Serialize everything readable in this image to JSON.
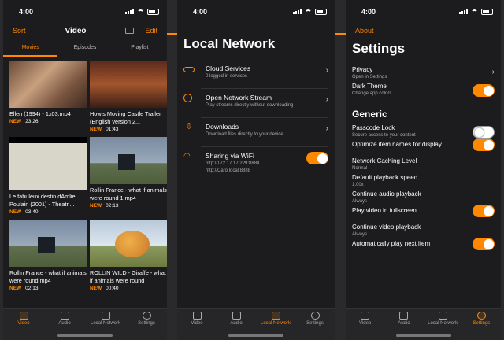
{
  "status": {
    "time": "4:00"
  },
  "colors": {
    "accent": "#ff8800",
    "background": "#1c1c1e"
  },
  "screen1": {
    "nav": {
      "left": "Sort",
      "title": "Video",
      "right": "Edit",
      "cast_icon": "cast-icon"
    },
    "tabs": [
      "Movies",
      "Episodes",
      "Playlist"
    ],
    "videos": [
      {
        "title": "Ellen (1994) - 1x03.mp4",
        "badge": "NEW",
        "duration": "23:26"
      },
      {
        "title": "Howls Moving Castle Trailer (English version 2...",
        "badge": "NEW",
        "duration": "01:43"
      },
      {
        "title": "Le fabuleux destin dAmlie Poulain (2001) - Theatri...",
        "badge": "NEW",
        "duration": "03:40"
      },
      {
        "title": "Rollin France - what if animals were round 1.mp4",
        "badge": "NEW",
        "duration": "02:13"
      },
      {
        "title": "Rollin France - what if animals were round.mp4",
        "badge": "NEW",
        "duration": "02:13"
      },
      {
        "title": "ROLLIN WILD - Giraffe - what if animals were round",
        "badge": "NEW",
        "duration": "00:40"
      }
    ]
  },
  "screen2": {
    "title": "Local Network",
    "rows": [
      {
        "label": "Cloud Services",
        "sub": "0 logged in services",
        "icon": "cloud-icon"
      },
      {
        "label": "Open Network Stream",
        "sub": "Play streams directly without downloading",
        "icon": "globe-icon"
      },
      {
        "label": "Downloads",
        "sub": "Download files directly to your device",
        "icon": "download-icon"
      }
    ],
    "wifi": {
      "label": "Sharing via WiFi",
      "sub1": "http://172.17.17.229:8888",
      "sub2": "http://Caro.local:8888",
      "enabled": true
    }
  },
  "screen3": {
    "back": "About",
    "title": "Settings",
    "rows_top": [
      {
        "label": "Privacy",
        "sub": "Open in Settings",
        "control": "chevron"
      },
      {
        "label": "Dark Theme",
        "sub": "Change app colors",
        "control": "toggle",
        "on": true
      }
    ],
    "section": "Generic",
    "rows": [
      {
        "label": "Passcode Lock",
        "sub": "Secure access to your content",
        "control": "toggle",
        "on": false
      },
      {
        "label": "Optimize item names for display",
        "sub": "",
        "control": "toggle",
        "on": true
      },
      {
        "label": "Network Caching Level",
        "sub": "Normal",
        "control": "none"
      },
      {
        "label": "Default playback speed",
        "sub": "1.00x",
        "control": "none"
      },
      {
        "label": "Continue audio playback",
        "sub": "Always",
        "control": "none"
      },
      {
        "label": "Play video in fullscreen",
        "sub": "",
        "control": "toggle",
        "on": true
      },
      {
        "label": "Continue video playback",
        "sub": "Always",
        "control": "none"
      },
      {
        "label": "Automatically play next item",
        "sub": "",
        "control": "toggle",
        "on": true
      }
    ]
  },
  "tabbar": [
    {
      "label": "Video",
      "icon": "video-icon"
    },
    {
      "label": "Audio",
      "icon": "audio-icon"
    },
    {
      "label": "Local Network",
      "icon": "local-network-icon"
    },
    {
      "label": "Settings",
      "icon": "settings-icon"
    }
  ]
}
